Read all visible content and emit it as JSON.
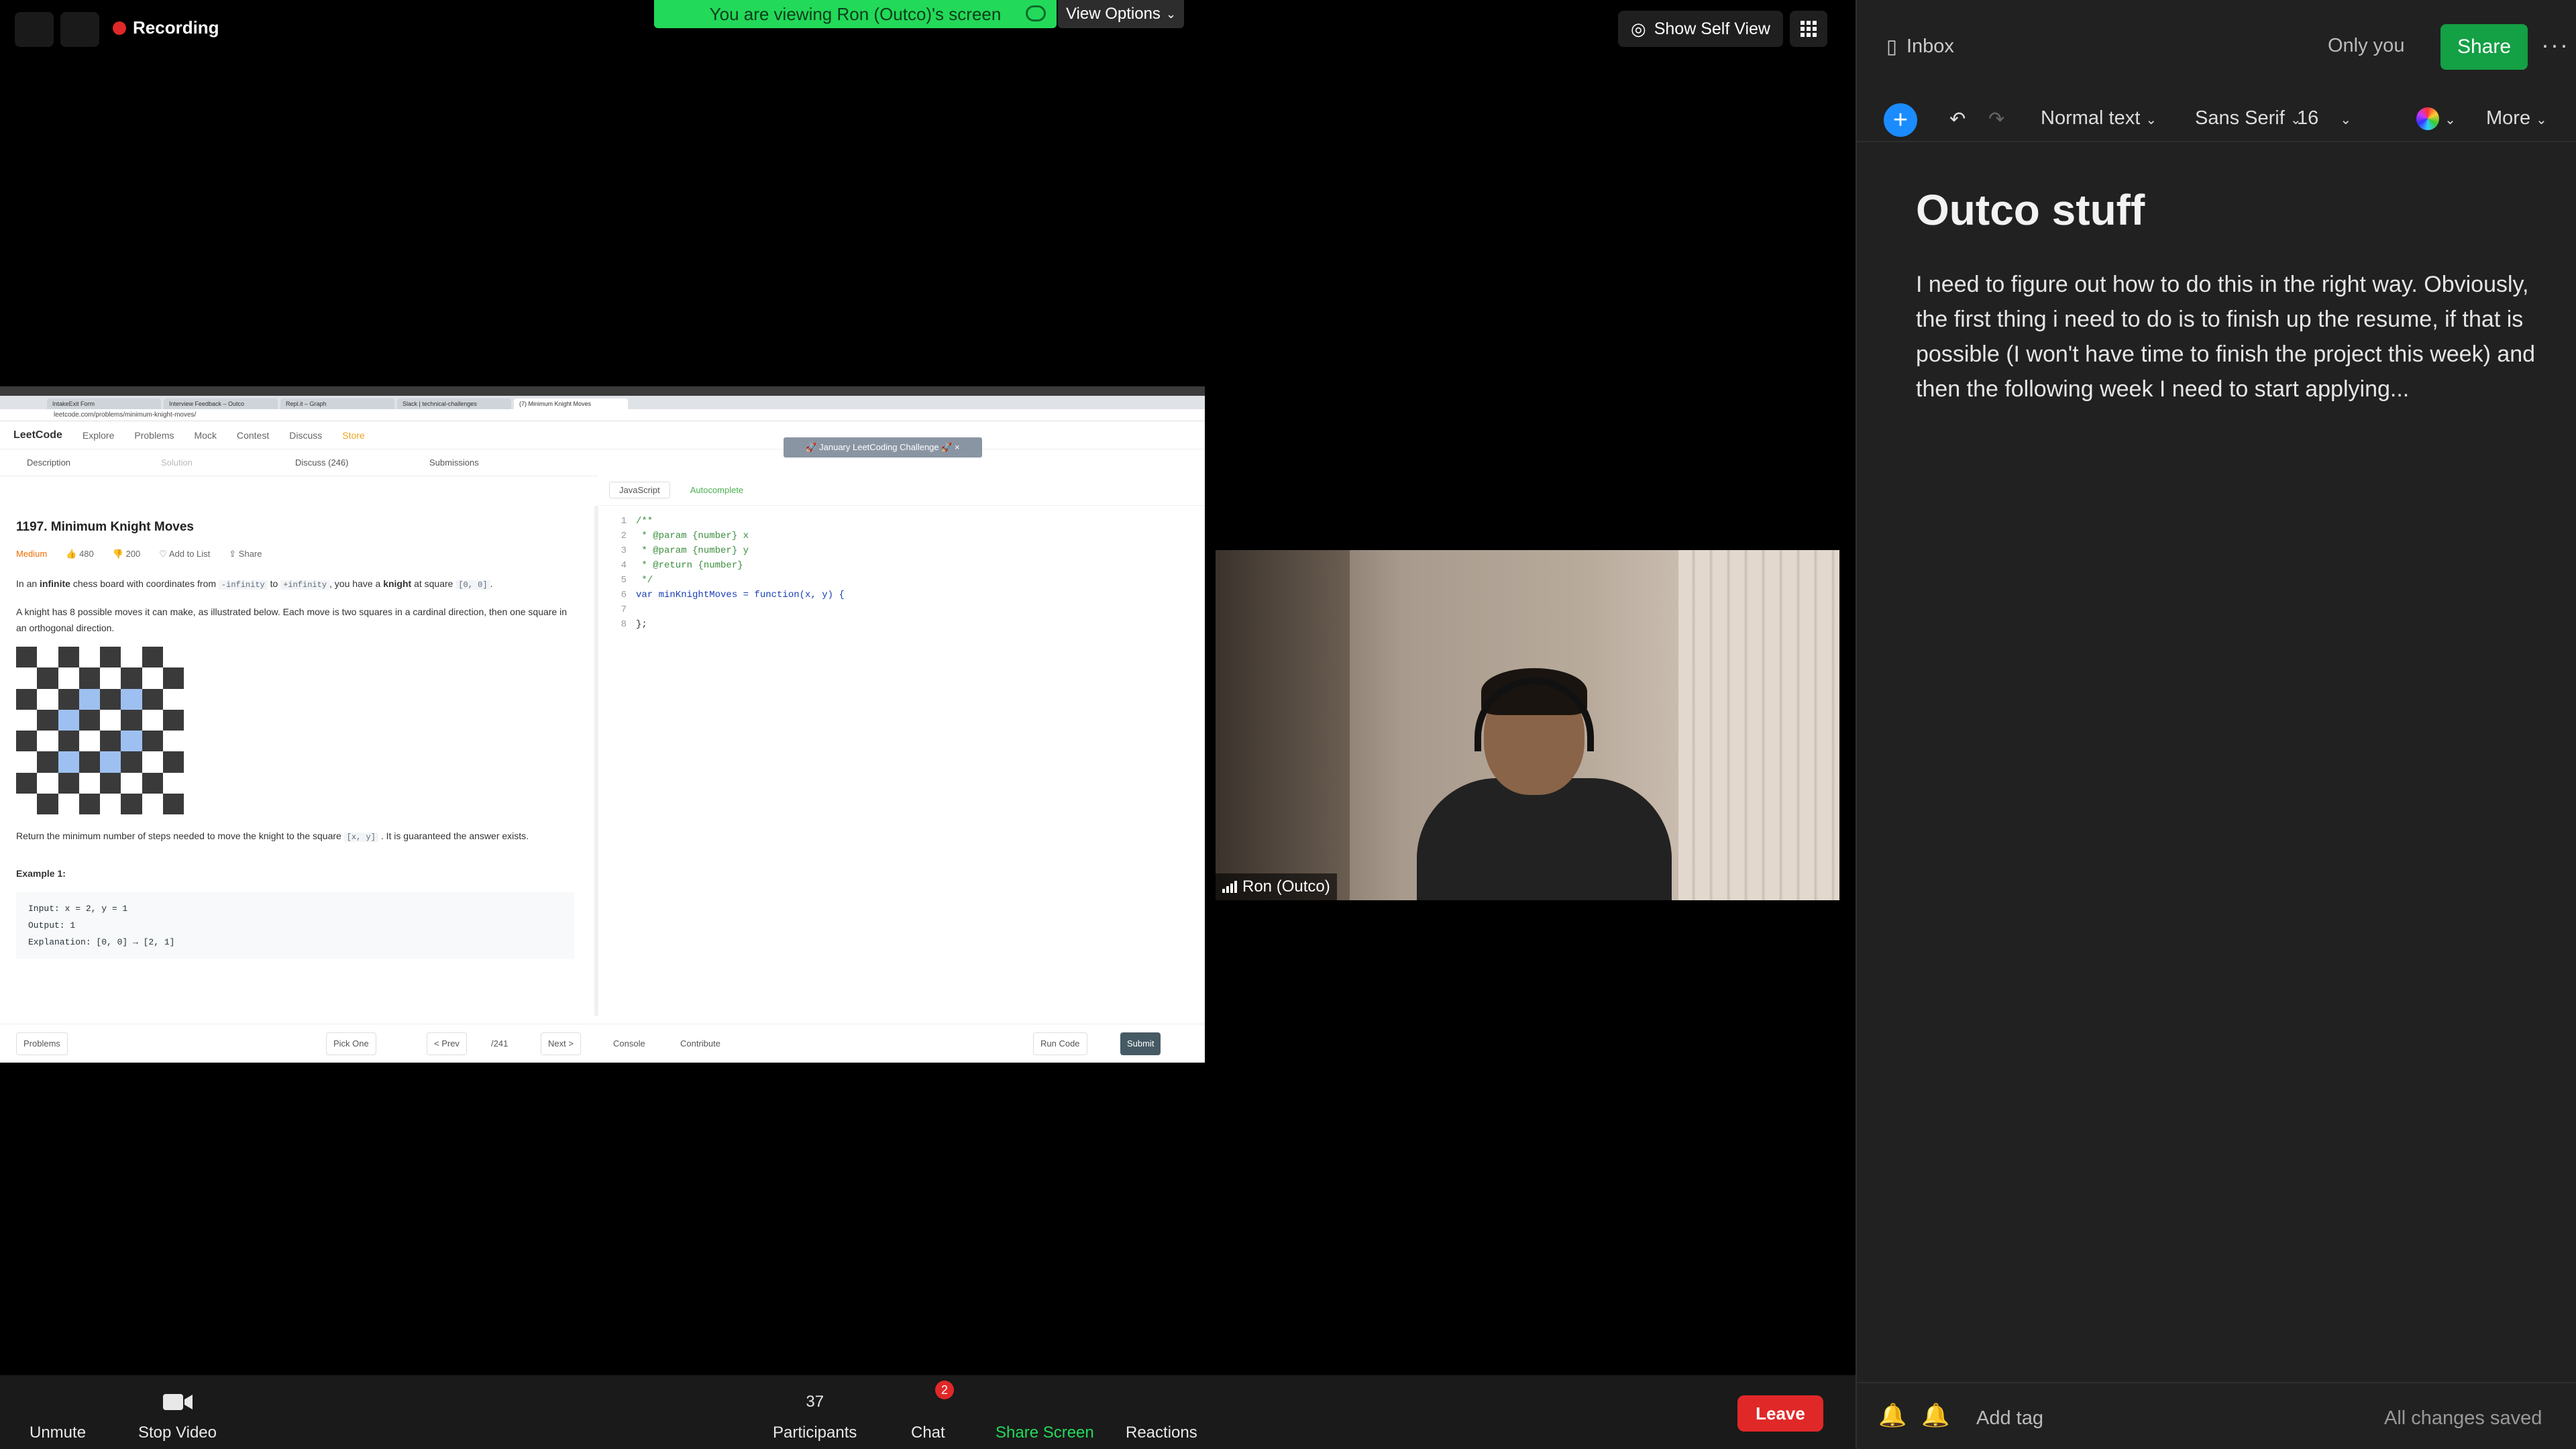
{
  "zoom": {
    "recording_label": "Recording",
    "banner": "You are viewing Ron (Outco)'s screen",
    "view_options": "View Options",
    "show_self_view": "Show Self View",
    "participant_name": "Ron (Outco)",
    "toolbar": {
      "unmute": "Unmute",
      "stop_video": "Stop Video",
      "participants": "Participants",
      "participants_count": "37",
      "chat": "Chat",
      "chat_badge": "2",
      "share_screen": "Share Screen",
      "reactions": "Reactions",
      "leave": "Leave"
    }
  },
  "shared_screen": {
    "browser_tabs": [
      "IntakeExit Form",
      "Interview Feedback – Outco",
      "Repl.it – Graph",
      "Slack | technical-challenges",
      "(7) Minimum Knight Moves"
    ],
    "url": "leetcode.com/problems/minimum-knight-moves/",
    "nav": {
      "logo": "LeetCode",
      "items": [
        "Explore",
        "Problems",
        "Mock",
        "Contest",
        "Discuss",
        "Store"
      ]
    },
    "challenge_banner": "🚀 January LeetCoding Challenge 🚀 ×",
    "subtabs": [
      "Description",
      "Solution",
      "Discuss (246)",
      "Submissions"
    ],
    "problem": {
      "title": "1197. Minimum Knight Moves",
      "difficulty": "Medium",
      "likes": "480",
      "dislikes": "200",
      "add_to_list": "Add to List",
      "share": "Share",
      "p1_a": "In an",
      "p1_bold": "infinite",
      "p1_b": "chess board with coordinates from",
      "p1_c1": "-infinity",
      "p1_to": "to",
      "p1_c2": "+infinity",
      "p1_d": ", you have a",
      "p1_knight": "knight",
      "p1_e": "at square",
      "p1_c3": "[0, 0]",
      "p2": "A knight has 8 possible moves it can make, as illustrated below. Each move is two squares in a cardinal direction, then one square in an orthogonal direction.",
      "p3_a": "Return the minimum number of steps needed to move the knight to the square",
      "p3_code": "[x, y]",
      "p3_b": ". It is guaranteed the answer exists.",
      "example_title": "Example 1:",
      "example_lines": [
        "Input: x = 2, y = 1",
        "Output: 1",
        "Explanation: [0, 0] → [2, 1]"
      ]
    },
    "editor": {
      "language": "JavaScript",
      "autocomplete": "Autocomplete",
      "lines": [
        {
          "n": "1",
          "t": "/**",
          "c": "cm"
        },
        {
          "n": "2",
          "t": " * @param {number} x",
          "c": "cm"
        },
        {
          "n": "3",
          "t": " * @param {number} y",
          "c": "cm"
        },
        {
          "n": "4",
          "t": " * @return {number}",
          "c": "cm"
        },
        {
          "n": "5",
          "t": " */",
          "c": "cm"
        },
        {
          "n": "6",
          "t": "var minKnightMoves = function(x, y) {",
          "c": "kw"
        },
        {
          "n": "7",
          "t": "",
          "c": ""
        },
        {
          "n": "8",
          "t": "};",
          "c": ""
        }
      ]
    },
    "footer": {
      "problems": "Problems",
      "pick_one": "Pick One",
      "prev": "< Prev",
      "page": "/241",
      "next": "Next >",
      "console": "Console",
      "contribute": "Contribute",
      "run_code": "Run Code",
      "submit": "Submit"
    }
  },
  "notes": {
    "inbox": "Inbox",
    "only_you": "Only you",
    "share": "Share",
    "more_dots": "···",
    "format": {
      "style": "Normal text",
      "font": "Sans Serif",
      "size": "16",
      "more": "More"
    },
    "title": "Outco stuff",
    "body": "I need to figure out how to do this in the right way. Obviously, the first thing i need to do is to finish up the resume, if that is possible (I won't have time to finish the project this week) and then the following week I need to start applying...",
    "add_tag": "Add tag",
    "status": "All changes saved"
  },
  "colors": {
    "banner_green": "#23d959",
    "leave_red": "#e02828",
    "notes_share_green": "#14a044",
    "notes_plus_blue": "#1a8cff"
  }
}
